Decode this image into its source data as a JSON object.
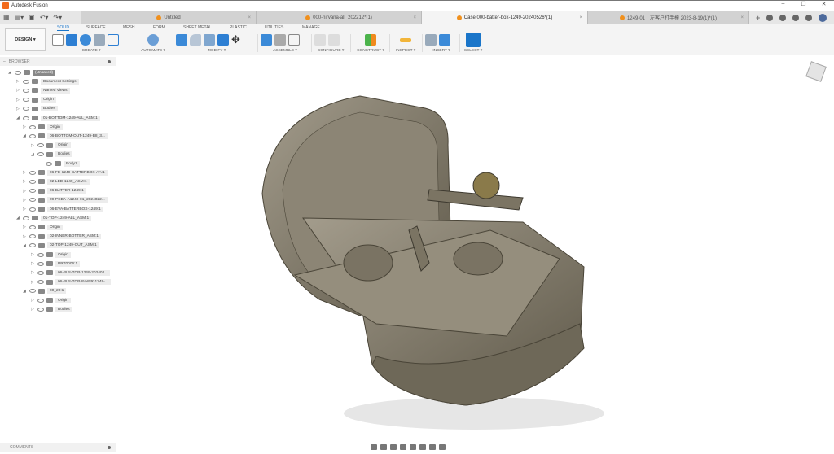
{
  "window": {
    "title": "Autodesk Fusion",
    "controls": [
      "–",
      "☐",
      "✕"
    ]
  },
  "tabs": [
    {
      "label": "Untitled",
      "active": false
    },
    {
      "label": "000-nirvana-all_202212*(1)",
      "active": false
    },
    {
      "label": "Case 000-batter-box-1249-20240526*(1)",
      "active": true
    },
    {
      "label": "1249-01　左客户打手模 2023-8-19(1)*(1)",
      "active": false
    }
  ],
  "toolbar": {
    "workspace": "DESIGN ▾",
    "tabs": [
      "SOLID",
      "SURFACE",
      "MESH",
      "FORM",
      "SHEET METAL",
      "PLASTIC",
      "UTILITIES",
      "MANAGE"
    ],
    "groups": [
      "CREATE ▾",
      "AUTOMATE ▾",
      "MODIFY ▾",
      "ASSEMBLE ▾",
      "CONFIGURE ▾",
      "CONSTRUCT ▾",
      "INSPECT ▾",
      "INSERT ▾",
      "SELECT ▾"
    ]
  },
  "browser": {
    "title": "BROWSER",
    "items": [
      {
        "label": "(Unsaved)",
        "level": 0,
        "exp": "◢"
      },
      {
        "label": "Document Settings",
        "level": 1,
        "exp": "▷"
      },
      {
        "label": "Named Views",
        "level": 1,
        "exp": "▷"
      },
      {
        "label": "Origin",
        "level": 1,
        "exp": "▷"
      },
      {
        "label": "Bodies",
        "level": 1,
        "exp": "▷"
      },
      {
        "label": "01-BOTTOM-1249-ALL_ASM:1",
        "level": 1,
        "exp": "◢"
      },
      {
        "label": "Origin",
        "level": 2,
        "exp": "▷"
      },
      {
        "label": "06-BOTTOM-OUT-1249-B8_3...",
        "level": 2,
        "exp": "◢"
      },
      {
        "label": "Origin",
        "level": 3,
        "exp": "▷"
      },
      {
        "label": "Bodies",
        "level": 3,
        "exp": "◢"
      },
      {
        "label": "Body1",
        "level": 4,
        "exp": ""
      },
      {
        "label": "06-FE-1249-BATTERBOX-AA:1",
        "level": 2,
        "exp": "▷"
      },
      {
        "label": "02-LED-1249_ASM:1",
        "level": 2,
        "exp": "▷"
      },
      {
        "label": "06-BATTER-1249:1",
        "level": 2,
        "exp": "▷"
      },
      {
        "label": "09-PCBA-A1249-01_2024022...",
        "level": 2,
        "exp": "▷"
      },
      {
        "label": "06-EVA-BATTERBOX-1249:1",
        "level": 2,
        "exp": "▷"
      },
      {
        "label": "01-TOP-1249-ALL_ASM:1",
        "level": 1,
        "exp": "◢"
      },
      {
        "label": "Origin",
        "level": 2,
        "exp": "▷"
      },
      {
        "label": "02-INNER-BOTTER_ASM:1",
        "level": 2,
        "exp": "▷"
      },
      {
        "label": "02-TOP-1249-OUT_ASM:1",
        "level": 2,
        "exp": "◢"
      },
      {
        "label": "Origin",
        "level": 3,
        "exp": "▷"
      },
      {
        "label": "PRT0006:1",
        "level": 3,
        "exp": "▷"
      },
      {
        "label": "06-PLS-TOP-1249-202402...",
        "level": 3,
        "exp": "▷"
      },
      {
        "label": "06-PLS-TOP-INNER-1249-...",
        "level": 3,
        "exp": "▷"
      },
      {
        "label": "00_20:1",
        "level": 2,
        "exp": "◢"
      },
      {
        "label": "Origin",
        "level": 3,
        "exp": "▷"
      },
      {
        "label": "Bodies",
        "level": 3,
        "exp": "▷"
      }
    ]
  },
  "comments": {
    "label": "COMMENTS"
  },
  "colors": {
    "accent": "#1a75c9",
    "model": "#8a8272",
    "brand": "#f26b1d"
  }
}
